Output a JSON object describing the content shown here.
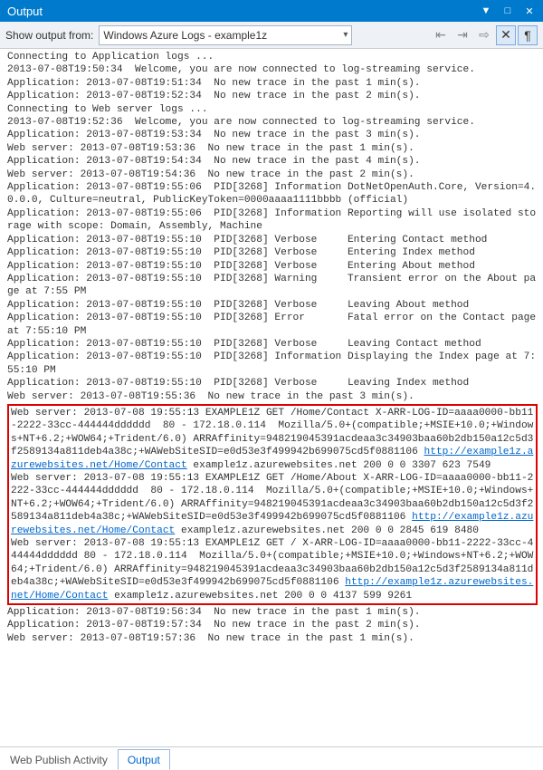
{
  "window": {
    "title": "Output"
  },
  "toolbar": {
    "label": "Show output from:",
    "dropdown_value": "Windows Azure Logs - example1z"
  },
  "footer": {
    "tab1": "Web Publish Activity",
    "tab2": "Output"
  },
  "log": {
    "pre1": "Connecting to Application logs ...\n2013-07-08T19:50:34  Welcome, you are now connected to log-streaming service.\nApplication: 2013-07-08T19:51:34  No new trace in the past 1 min(s).\nApplication: 2013-07-08T19:52:34  No new trace in the past 2 min(s).\nConnecting to Web server logs ...\n2013-07-08T19:52:36  Welcome, you are now connected to log-streaming service.\nApplication: 2013-07-08T19:53:34  No new trace in the past 3 min(s).\nWeb server: 2013-07-08T19:53:36  No new trace in the past 1 min(s).\nApplication: 2013-07-08T19:54:34  No new trace in the past 4 min(s).\nWeb server: 2013-07-08T19:54:36  No new trace in the past 2 min(s).\nApplication: 2013-07-08T19:55:06  PID[3268] Information DotNetOpenAuth.Core, Version=4.0.0.0, Culture=neutral, PublicKeyToken=0000aaaa1111bbbb (official)\nApplication: 2013-07-08T19:55:06  PID[3268] Information Reporting will use isolated storage with scope: Domain, Assembly, Machine\nApplication: 2013-07-08T19:55:10  PID[3268] Verbose     Entering Contact method\nApplication: 2013-07-08T19:55:10  PID[3268] Verbose     Entering Index method\nApplication: 2013-07-08T19:55:10  PID[3268] Verbose     Entering About method\nApplication: 2013-07-08T19:55:10  PID[3268] Warning     Transient error on the About page at 7:55 PM\nApplication: 2013-07-08T19:55:10  PID[3268] Verbose     Leaving About method\nApplication: 2013-07-08T19:55:10  PID[3268] Error       Fatal error on the Contact page at 7:55:10 PM\nApplication: 2013-07-08T19:55:10  PID[3268] Verbose     Leaving Contact method\nApplication: 2013-07-08T19:55:10  PID[3268] Information Displaying the Index page at 7:55:10 PM\nApplication: 2013-07-08T19:55:10  PID[3268] Verbose     Leaving Index method\nWeb server: 2013-07-08T19:55:36  No new trace in the past 3 min(s).",
    "box1a": "Web server: 2013-07-08 19:55:13 EXAMPLE1Z GET /Home/Contact X-ARR-LOG-ID=aaaa0000-bb11-2222-33cc-444444dddddd  80 - 172.18.0.114  Mozilla/5.0+(compatible;+MSIE+10.0;+Windows+NT+6.2;+WOW64;+Trident/6.0) ARRAffinity=948219045391acdeaa3c34903baa60b2db150a12c5d3f2589134a811deb4a38c;+WAWebSiteSID=e0d53e3f499942b699075cd5f0881106 ",
    "box1link": "http://example1z.azurewebsites.net/Home/Contact",
    "box1b": " example1z.azurewebsites.net 200 0 0 3307 623 7549",
    "box2a": "Web server: 2013-07-08 19:55:13 EXAMPLE1Z GET /Home/About X-ARR-LOG-ID=aaaa0000-bb11-2222-33cc-444444dddddd  80 - 172.18.0.114  Mozilla/5.0+(compatible;+MSIE+10.0;+Windows+NT+6.2;+WOW64;+Trident/6.0) ARRAffinity=948219045391acdeaa3c34903baa60b2db150a12c5d3f2589134a811deb4a38c;+WAWebSiteSID=e0d53e3f499942b699075cd5f0881106 ",
    "box2link": "http://example1z.azurewebsites.net/Home/Contact",
    "box2b": " example1z.azurewebsites.net 200 0 0 2845 619 8480",
    "box3a": "Web server: 2013-07-08 19:55:13 EXAMPLE1Z GET / X-ARR-LOG-ID=aaaa0000-bb11-2222-33cc-444444dddddd 80 - 172.18.0.114  Mozilla/5.0+(compatible;+MSIE+10.0;+Windows+NT+6.2;+WOW64;+Trident/6.0) ARRAffinity=948219045391acdeaa3c34903baa60b2db150a12c5d3f2589134a811deb4a38c;+WAWebSiteSID=e0d53e3f499942b699075cd5f0881106 ",
    "box3link": "http://example1z.azurewebsites.net/Home/Contact",
    "box3b": " example1z.azurewebsites.net 200 0 0 4137 599 9261",
    "post1": "Application: 2013-07-08T19:56:34  No new trace in the past 1 min(s).\nApplication: 2013-07-08T19:57:34  No new trace in the past 2 min(s).\nWeb server: 2013-07-08T19:57:36  No new trace in the past 1 min(s)."
  }
}
